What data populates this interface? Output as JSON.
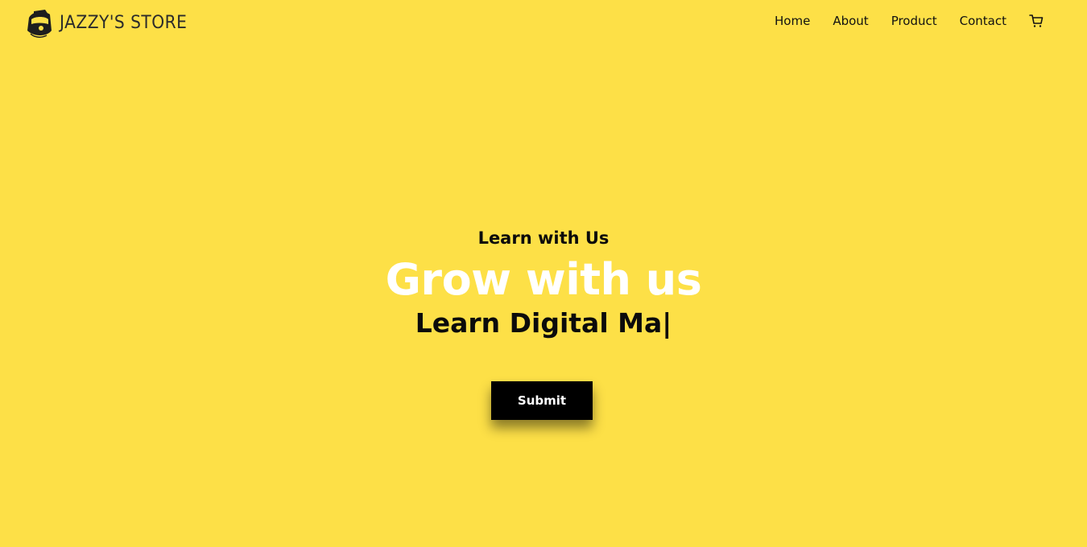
{
  "nav": {
    "brand_name": "JAZZY'S STORE",
    "links": [
      {
        "label": "Home"
      },
      {
        "label": "About"
      },
      {
        "label": "Product"
      },
      {
        "label": "Contact"
      }
    ],
    "cart_icon": "shopping-cart-icon"
  },
  "hero": {
    "kicker": "Learn with Us",
    "title": "Grow with us",
    "typed_text": "Learn Digital Ma",
    "cursor": "|",
    "button_label": "Submit"
  },
  "colors": {
    "background": "#fde047",
    "title": "#ffffff",
    "button_bg": "#000000",
    "button_text": "#ffffff"
  }
}
